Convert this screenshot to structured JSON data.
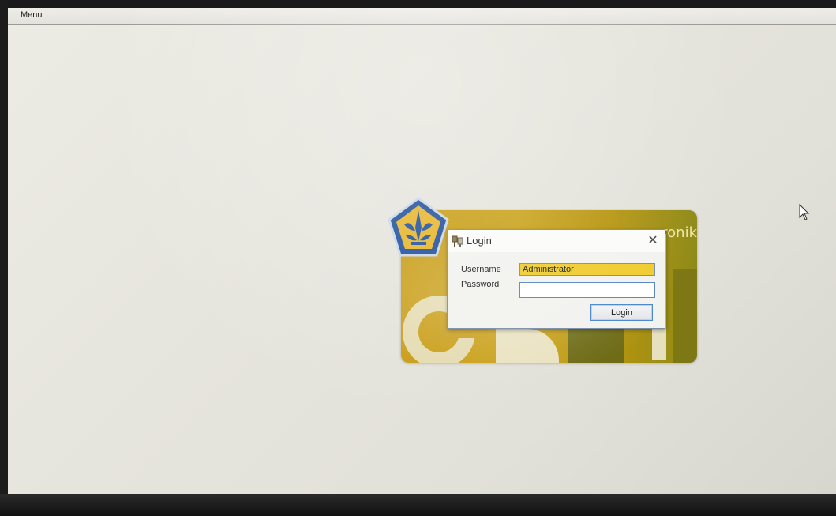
{
  "menubar": {
    "menu_label": "Menu"
  },
  "splash": {
    "title_fragment": "ronik"
  },
  "dialog": {
    "title": "Login",
    "close_glyph": "✕",
    "username_label": "Username",
    "username_value": "Administrator",
    "password_label": "Password",
    "password_value": "",
    "login_button": "Login"
  },
  "icons": {
    "emblem": "kemenkeu-emblem-icon",
    "dialog": "login-keys-icon",
    "close": "close-icon",
    "cursor": "mouse-pointer-icon"
  },
  "colors": {
    "splash_gold": "#c79a10",
    "splash_olive": "#7d7814",
    "username_highlight": "#f0cc2e",
    "focus_border": "#4d87cf",
    "emblem_blue": "#1f4f9b",
    "emblem_gold": "#e7b52a"
  }
}
